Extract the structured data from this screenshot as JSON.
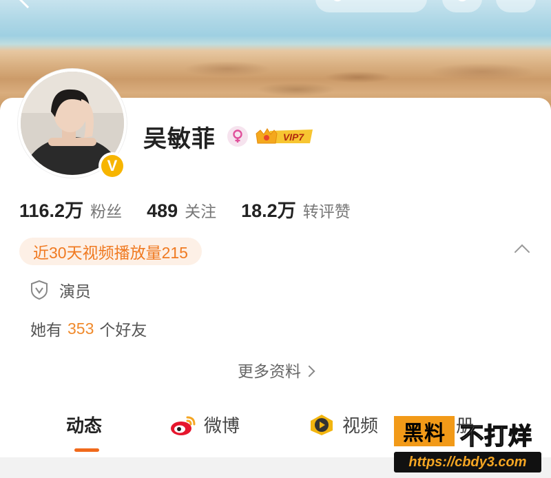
{
  "profile": {
    "name": "吴敏菲",
    "vip_label": "VIP7",
    "verified_mark": "V"
  },
  "stats": [
    {
      "value": "116.2万",
      "label": "粉丝"
    },
    {
      "value": "489",
      "label": "关注"
    },
    {
      "value": "18.2万",
      "label": "转评赞"
    }
  ],
  "play_count": "近30天视频播放量215",
  "occupation": "演员",
  "friends": {
    "prefix": "她有",
    "count": "353",
    "suffix": "个好友"
  },
  "more_info": "更多资料",
  "tabs": [
    {
      "label": "动态",
      "active": true
    },
    {
      "label": "微博",
      "icon": "weibo-logo-icon"
    },
    {
      "label": "视频",
      "icon": "video-play-icon"
    },
    {
      "label": "相册"
    }
  ],
  "watermark": {
    "box": "黑料",
    "text": "不打烊",
    "url": "https://cbdy3.com"
  },
  "colors": {
    "accent": "#f06a1c",
    "play_pill_bg": "#fdf0e6",
    "play_pill_text": "#f07a21",
    "verified": "#f7b500"
  }
}
